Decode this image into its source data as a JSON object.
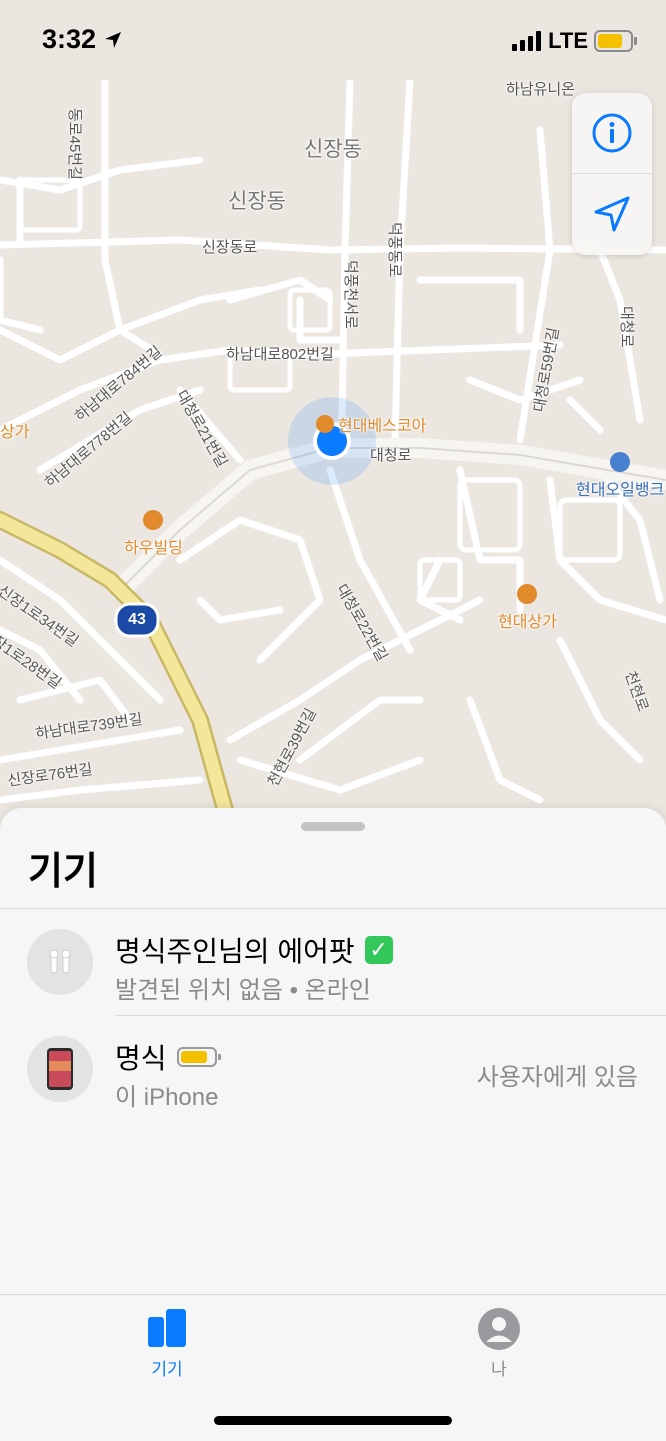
{
  "status": {
    "time": "3:32",
    "network": "LTE"
  },
  "map": {
    "labels": {
      "sinjang1": "신장동",
      "sinjang2": "신장동",
      "sinjangdongro": "신장동로",
      "dodal45": "동로45번길",
      "hanam802": "하남대로802번길",
      "hanam784": "하남대로784번길",
      "hanam778": "하남대로778번길",
      "daecheong21": "대청로21번길",
      "daecheong22": "대청로22번길",
      "daecheongro": "대청로",
      "deokpung": "덕풍천서로",
      "deokpung2": "덕풍동로",
      "daecheong59": "대청로59번길",
      "sinjang1ro34": "신장1로34번길",
      "sinjang1ro28": "장1로28번길",
      "hanam739": "하남대로739번길",
      "sinjang76": "신장로76번길",
      "cheonhyeon39": "천현로39번길",
      "cheonhyeonro": "천현로",
      "daecheong_right": "대청로",
      "hanam_uni": "하남유니온",
      "poi_hyundai_bescoa": "현대베스코아",
      "poi_hau": "하우빌딩",
      "poi_hyundai_sangga": "현대상가",
      "poi_hyundai_oil": "현대오일뱅크",
      "poi_left": "상가",
      "route": "43"
    }
  },
  "sheet": {
    "title": "기기",
    "devices": [
      {
        "name": "명식주인님의 에어팟",
        "status": "발견된 위치 없음 • 온라인",
        "right": ""
      },
      {
        "name": "명식",
        "status": "이 iPhone",
        "right": "사용자에게 있음"
      }
    ]
  },
  "tabs": [
    {
      "label": "기기",
      "active": true
    },
    {
      "label": "나",
      "active": false
    }
  ],
  "colors": {
    "accent": "#0a7aff",
    "battery": "#f5c000",
    "poi": "#e08a2c",
    "check": "#34c759"
  }
}
